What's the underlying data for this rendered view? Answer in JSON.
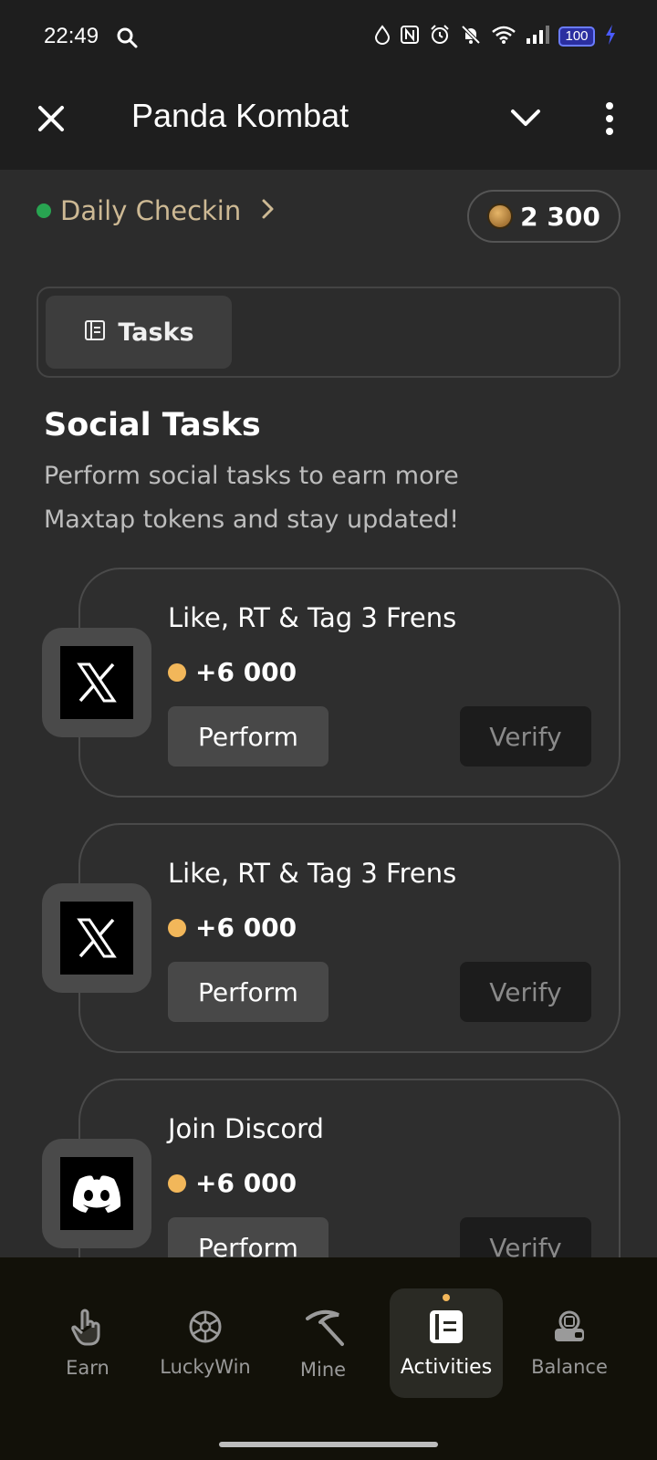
{
  "status_bar": {
    "time": "22:49",
    "battery": "100",
    "icons": [
      "search-icon",
      "data-saver-icon",
      "nfc-icon",
      "alarm-icon",
      "mute-icon",
      "wifi-icon",
      "signal-icon",
      "battery-icon",
      "charging-icon"
    ]
  },
  "app_bar": {
    "title": "Panda Kombat",
    "icons": [
      "close-icon",
      "chevron-down-icon",
      "more-vert-icon"
    ]
  },
  "checkin": {
    "label": "Daily Checkin",
    "status_color": "#28a451",
    "label_color": "#cdb994"
  },
  "balance": {
    "value": "2 300"
  },
  "tabs": [
    {
      "label": "Tasks",
      "active": true
    }
  ],
  "section": {
    "title": "Social Tasks",
    "description": "Perform social tasks to earn more Maxtap tokens and stay updated!"
  },
  "tasks": [
    {
      "icon": "x-logo-icon",
      "title": "Like, RT & Tag 3 Frens",
      "reward": "+6 000",
      "perform_label": "Perform",
      "verify_label": "Verify"
    },
    {
      "icon": "x-logo-icon",
      "title": "Like, RT & Tag 3 Frens",
      "reward": "+6 000",
      "perform_label": "Perform",
      "verify_label": "Verify"
    },
    {
      "icon": "discord-logo-icon",
      "title": "Join Discord",
      "reward": "+6 000",
      "perform_label": "Perform",
      "verify_label": "Verify"
    }
  ],
  "bottom_nav": [
    {
      "label": "Earn",
      "icon": "tap-hand-icon",
      "active": false
    },
    {
      "label": "LuckyWin",
      "icon": "wheel-icon",
      "active": false
    },
    {
      "label": "Mine",
      "icon": "pickaxe-icon",
      "active": false
    },
    {
      "label": "Activities",
      "icon": "activities-icon",
      "active": true
    },
    {
      "label": "Balance",
      "icon": "wallet-icon",
      "active": false
    }
  ],
  "colors": {
    "accent": "#f2b75a",
    "background": "#2c2c2c",
    "nav_background": "#121109"
  }
}
